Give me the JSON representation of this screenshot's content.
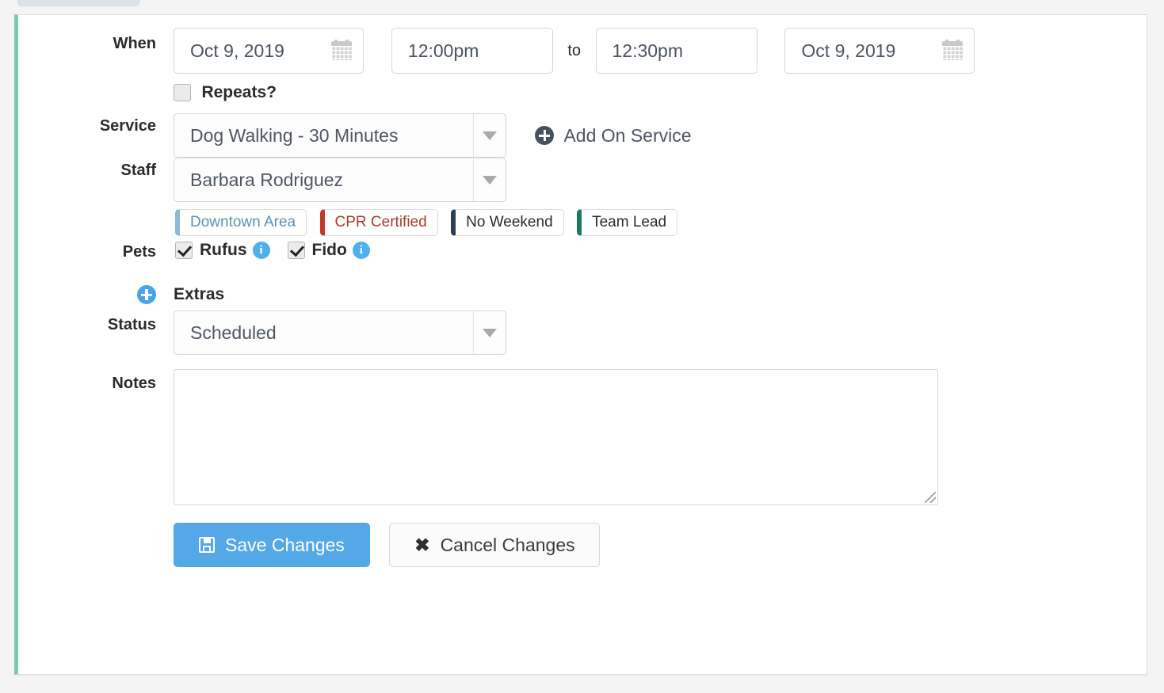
{
  "card": {
    "accent_color": "#7fc8a9"
  },
  "form": {
    "when": {
      "label": "When",
      "start_date": "Oct 9, 2019",
      "start_time": "12:00pm",
      "separator": "to",
      "end_time": "12:30pm",
      "end_date": "Oct 9, 2019",
      "calendar_icon": "calendar-icon"
    },
    "repeats": {
      "label": "Repeats?",
      "checked": false
    },
    "service": {
      "label": "Service",
      "value": "Dog Walking - 30 Minutes",
      "addon_label": "Add On Service",
      "addon_icon": "plus-circle-icon",
      "addon_icon_color": "#45525e"
    },
    "staff": {
      "label": "Staff",
      "value": "Barbara Rodriguez",
      "tags": [
        {
          "label": "Downtown Area",
          "color": "#8cb9d4"
        },
        {
          "label": "CPR Certified",
          "color": "#c0392b"
        },
        {
          "label": "No Weekend",
          "color": "#2c3e50"
        },
        {
          "label": "Team Lead",
          "color": "#1e7a5a"
        }
      ]
    },
    "pets": {
      "label": "Pets",
      "items": [
        {
          "name": "Rufus",
          "checked": true,
          "info_icon": "info-icon"
        },
        {
          "name": "Fido",
          "checked": true,
          "info_icon": "info-icon"
        }
      ]
    },
    "extras": {
      "label": "Extras",
      "icon": "plus-circle-icon",
      "icon_color": "#44a6e8"
    },
    "status": {
      "label": "Status",
      "value": "Scheduled"
    },
    "notes": {
      "label": "Notes",
      "value": "",
      "placeholder": ""
    },
    "actions": {
      "save_label": "Save Changes",
      "save_icon": "floppy-disk-icon",
      "save_color": "#54a8e8",
      "cancel_label": "Cancel Changes",
      "cancel_icon": "x-mark-icon",
      "cancel_glyph": "✖"
    }
  }
}
